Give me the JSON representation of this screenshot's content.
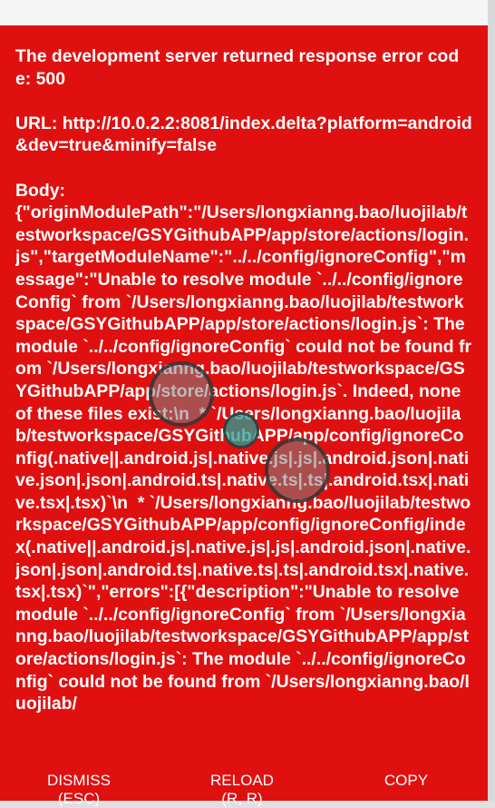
{
  "error": {
    "message": "The development server returned response error code: 500\n\nURL: http://10.0.2.2:8081/index.delta?platform=android&dev=true&minify=false\n\nBody:\n{\"originModulePath\":\"/Users/longxianng.bao/luojilab/testworkspace/GSYGithubAPP/app/store/actions/login.js\",\"targetModuleName\":\"../../config/ignoreConfig\",\"message\":\"Unable to resolve module `../../config/ignoreConfig` from `/Users/longxianng.bao/luojilab/testworkspace/GSYGithubAPP/app/store/actions/login.js`: The module `../../config/ignoreConfig` could not be found from `/Users/longxianng.bao/luojilab/testworkspace/GSYGithubAPP/app/store/actions/login.js`. Indeed, none of these files exist:\\n  * `/Users/longxianng.bao/luojilab/testworkspace/GSYGithubAPP/app/config/ignoreConfig(.native||.android.js|.native.js|.js|.android.json|.native.json|.json|.android.ts|.native.ts|.ts|.android.tsx|.native.tsx|.tsx)`\\n  * `/Users/longxianng.bao/luojilab/testworkspace/GSYGithubAPP/app/config/ignoreConfig/index(.native||.android.js|.native.js|.js|.android.json|.native.json|.json|.android.ts|.native.ts|.ts|.android.tsx|.native.tsx|.tsx)`\",\"errors\":[{\"description\":\"Unable to resolve module `../../config/ignoreConfig` from `/Users/longxianng.bao/luojilab/testworkspace/GSYGithubAPP/app/store/actions/login.js`: The module `../../config/ignoreConfig` could not be found from `/Users/longxianng.bao/luojilab/"
  },
  "buttons": {
    "dismiss_label": "DISMISS\n(ESC)",
    "reload_label": "RELOAD\n(R, R)",
    "copy_label": "COPY"
  },
  "colors": {
    "redbox_background": "#e01010",
    "text": "#ffffff"
  }
}
